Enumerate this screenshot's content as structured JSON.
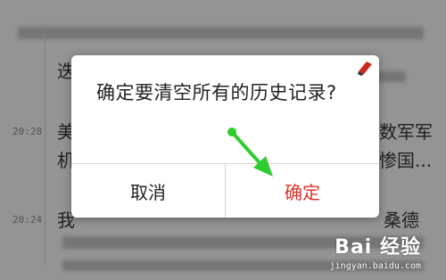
{
  "background": {
    "rows": [
      {
        "time": "",
        "text": "迭"
      },
      {
        "time": "20:28",
        "text": "美",
        "right_text": "数军军"
      },
      {
        "time": "",
        "text": "机",
        "right_text": "惨国..."
      },
      {
        "time": "20:24",
        "text": "我",
        "right_text": "桑德"
      }
    ]
  },
  "dialog": {
    "message": "确定要清空所有的历史记录?",
    "cancel_label": "取消",
    "ok_label": "确定",
    "ok_color": "#d9342b"
  },
  "annotation": {
    "arrow_color": "#2ecc2e"
  },
  "watermark": {
    "brand": "Bai 经验",
    "url": "jingyan.baidu.com"
  }
}
